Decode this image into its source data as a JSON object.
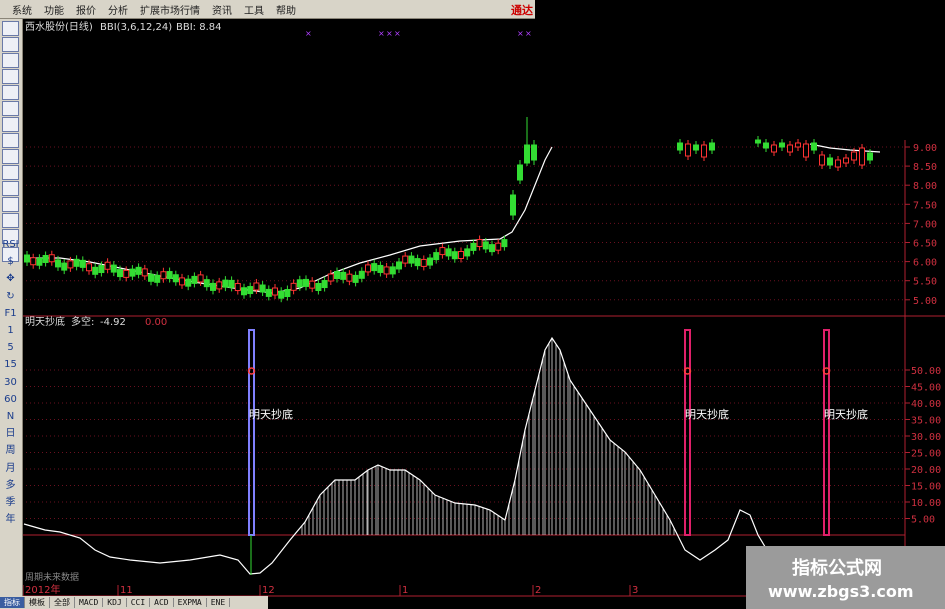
{
  "menu": [
    "系统",
    "功能",
    "报价",
    "分析",
    "扩展市场行情",
    "资讯",
    "工具",
    "帮助"
  ],
  "brand": "通达",
  "toolbar_icons": [
    "chart-icon",
    "chart-icon",
    "chart-icon",
    "chart-icon",
    "chart-icon",
    "chart-icon",
    "chart-icon",
    "chart-icon",
    "chart-icon",
    "chart-icon",
    "chart-icon",
    "chart-icon",
    "chart-icon",
    "chart-icon",
    "chart-icon"
  ],
  "toolbar_labels": [
    "RSI",
    "$",
    "✥",
    "↻",
    "F1",
    "1",
    "5",
    "15",
    "30",
    "60",
    "N",
    "日",
    "周",
    "月",
    "多",
    "季",
    "年"
  ],
  "main_chart": {
    "stock_title": "西水股份(日线)",
    "indicator": "BBI(3,6,12,24)",
    "indicator_value": "BBI: 8.84",
    "y_labels": [
      "9.00",
      "8.50",
      "8.00",
      "7.50",
      "7.00",
      "6.50",
      "6.00",
      "5.50",
      "5.00"
    ],
    "y_values": [
      9.0,
      8.5,
      8.0,
      7.5,
      7.0,
      6.5,
      6.0,
      5.5,
      5.0
    ],
    "up_color": "#ff3333",
    "down_color": "#33dd33",
    "bbi_color": "#ffffff"
  },
  "sub_chart": {
    "title": "明天抄底",
    "metric_label": "多空:",
    "metric_value": "-4.92",
    "second_value": "0.00",
    "y_labels": [
      "50.00",
      "45.00",
      "40.00",
      "35.00",
      "30.00",
      "25.00",
      "20.00",
      "15.00",
      "10.00",
      "5.00"
    ],
    "y_values": [
      50,
      45,
      40,
      35,
      30,
      25,
      20,
      15,
      10,
      5
    ],
    "signal_label": "明天抄底",
    "signal_count": 3,
    "axis_color": "#b02030"
  },
  "x_axis": {
    "labels": [
      "2012年",
      "11",
      "12",
      "1",
      "2",
      "3"
    ],
    "footer": "周期未来数据"
  },
  "bottom_tabs": [
    "指标",
    "模板",
    "全部",
    "MACD",
    "KDJ",
    "CCI",
    "ACD",
    "EXPMA",
    "ENE"
  ],
  "watermark": {
    "line1": "指标公式网",
    "line2": "www.zbgs3.com"
  }
}
